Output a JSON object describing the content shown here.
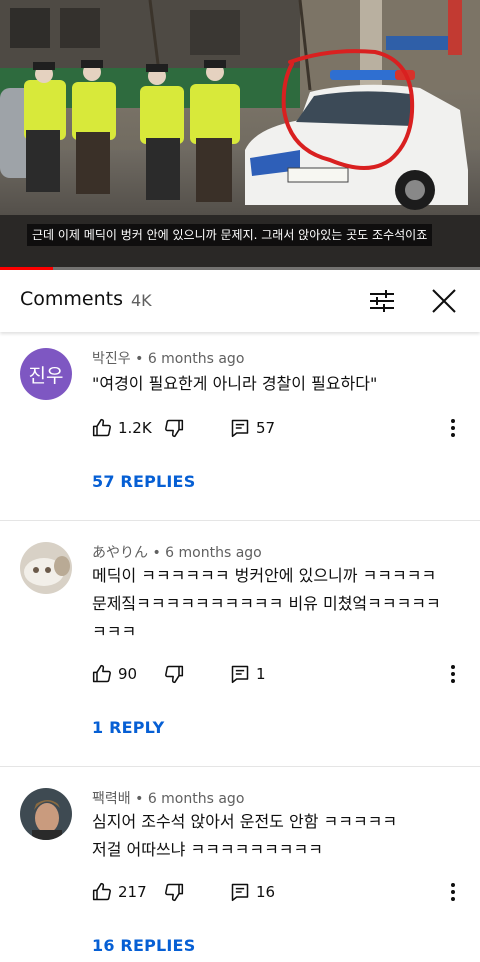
{
  "video": {
    "caption": "근데 이제 메딕이 벙커 안에 있으니까 문제지. 그래서 앉아있는 곳도 조수석이죠",
    "progress_fraction": 0.11,
    "colors": {
      "progress": "#ff0000",
      "circle": "#d92020"
    }
  },
  "comments_header": {
    "title": "Comments",
    "count": "4K",
    "icons": {
      "filter": "sliders-icon",
      "close": "close-icon"
    }
  },
  "comments": [
    {
      "author": "박진우",
      "time": "6 months ago",
      "avatar_letter": "진우",
      "text_lines": [
        "\"여경이 필요한게 아니라 경찰이 필요하다\""
      ],
      "likes": "1.2K",
      "reply_count": "57",
      "replies_label": "57 REPLIES"
    },
    {
      "author": "あやりん",
      "time": "6 months ago",
      "text_lines": [
        "메딕이 ㅋㅋㅋㅋㅋㅋ 벙커안에 있으니까 ㅋㅋㅋㅋㅋ",
        "문제짘ㅋㅋㅋㅋㅋㅋㅋㅋㅋㅋ 비유 미쳤엌ㅋㅋㅋㅋㅋ",
        "ㅋㅋㅋ"
      ],
      "likes": "90",
      "reply_count": "1",
      "replies_label": "1 REPLY"
    },
    {
      "author": "팩력배",
      "time": "6 months ago",
      "text_lines": [
        "심지어 조수석 앉아서 운전도 안함 ㅋㅋㅋㅋㅋ",
        "저걸 어따쓰냐 ㅋㅋㅋㅋㅋㅋㅋㅋㅋ"
      ],
      "likes": "217",
      "reply_count": "16",
      "replies_label": "16 REPLIES"
    }
  ],
  "theme": {
    "link": "#065fd4",
    "secondary_text": "#606060",
    "avatar_purple": "#7e57c2"
  }
}
